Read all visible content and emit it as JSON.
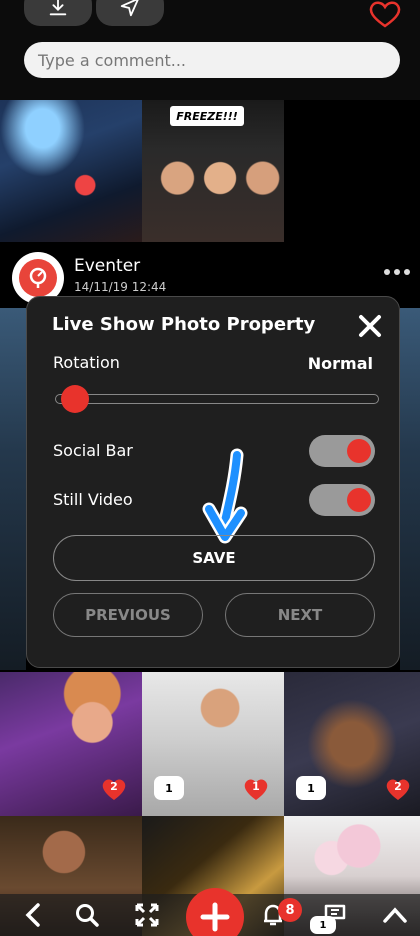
{
  "feed": {
    "comment_placeholder": "Type a comment...",
    "post": {
      "author": "Eventer",
      "timestamp": "14/11/19 12:44"
    },
    "freeze_sign": "FREEZE!!!",
    "grid_badges": [
      {
        "type": "likes",
        "count": "2"
      },
      {
        "type": "comments",
        "count": "1"
      },
      {
        "type": "likes",
        "count": "1"
      },
      {
        "type": "comments",
        "count": "1"
      },
      {
        "type": "likes",
        "count": "2"
      }
    ]
  },
  "modal": {
    "title": "Live Show Photo Property",
    "rotation_label": "Rotation",
    "rotation_value": "Normal",
    "rotation_slider_level": 0.0,
    "social_bar_label": "Social Bar",
    "social_bar_on": true,
    "still_video_label": "Still Video",
    "still_video_on": true,
    "save_label": "SAVE",
    "previous_label": "PREVIOUS",
    "next_label": "NEXT"
  },
  "bottom_nav": {
    "notification_count": "8",
    "bottom_badge": "1"
  },
  "colors": {
    "accent": "#e8332c",
    "modal_bg": "#1f1f1f",
    "hint_arrow": "#1e90ff"
  }
}
